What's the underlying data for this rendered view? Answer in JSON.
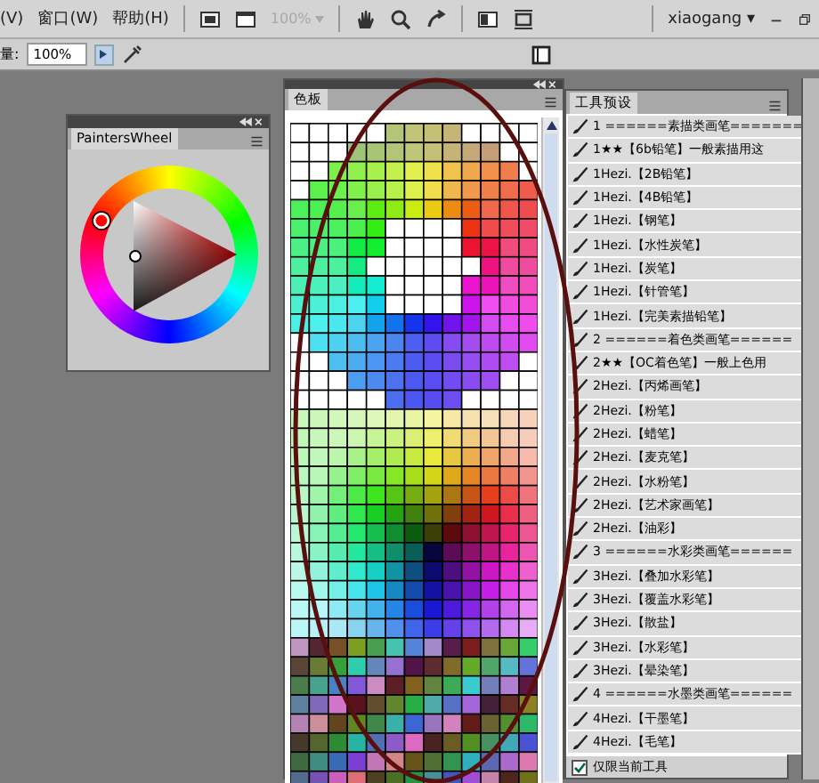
{
  "menu_bar": {
    "menus": [
      "(V)",
      "窗口(W)",
      "帮助(H)"
    ],
    "zoom_dropdown": "100%",
    "user": "xiaogang ▾"
  },
  "options_bar": {
    "flow_label": "量:",
    "flow_value": "100%"
  },
  "painters_wheel": {
    "tab": "PaintersWheel"
  },
  "swatches_panel": {
    "tab": "色板"
  },
  "tool_presets": {
    "tab": "工具预设",
    "rows": [
      {
        "label": "1 ======素描类画笔======="
      },
      {
        "label": "1★★【6b铅笔】一般素描用这"
      },
      {
        "label": "1Hezi.【2B铅笔】"
      },
      {
        "label": "1Hezi.【4B铅笔】"
      },
      {
        "label": "1Hezi.【钢笔】"
      },
      {
        "label": "1Hezi.【水性炭笔】"
      },
      {
        "label": "1Hezi.【炭笔】"
      },
      {
        "label": "1Hezi.【针管笔】"
      },
      {
        "label": "1Hezi.【完美素描铅笔】"
      },
      {
        "label": "2 ======着色类画笔======"
      },
      {
        "label": "2★★【OC着色笔】一般上色用"
      },
      {
        "label": "2Hezi.【丙烯画笔】"
      },
      {
        "label": "2Hezi.【粉笔】"
      },
      {
        "label": "2Hezi.【蜡笔】"
      },
      {
        "label": "2Hezi.【麦克笔】"
      },
      {
        "label": "2Hezi.【水粉笔】"
      },
      {
        "label": "2Hezi.【艺术家画笔】"
      },
      {
        "label": "2Hezi.【油彩】"
      },
      {
        "label": "3 ======水彩类画笔======"
      },
      {
        "label": "3Hezi.【叠加水彩笔】"
      },
      {
        "label": "3Hezi.【覆盖水彩笔】"
      },
      {
        "label": "3Hezi.【散盐】"
      },
      {
        "label": "3Hezi.【水彩笔】"
      },
      {
        "label": "3Hezi.【晕染笔】"
      },
      {
        "label": "4 ======水墨类画笔======"
      },
      {
        "label": "4Hezi.【干墨笔】"
      },
      {
        "label": "4Hezi.【毛笔】"
      }
    ],
    "current_tool_only": {
      "label": "仅限当前工具",
      "checked": true
    }
  }
}
